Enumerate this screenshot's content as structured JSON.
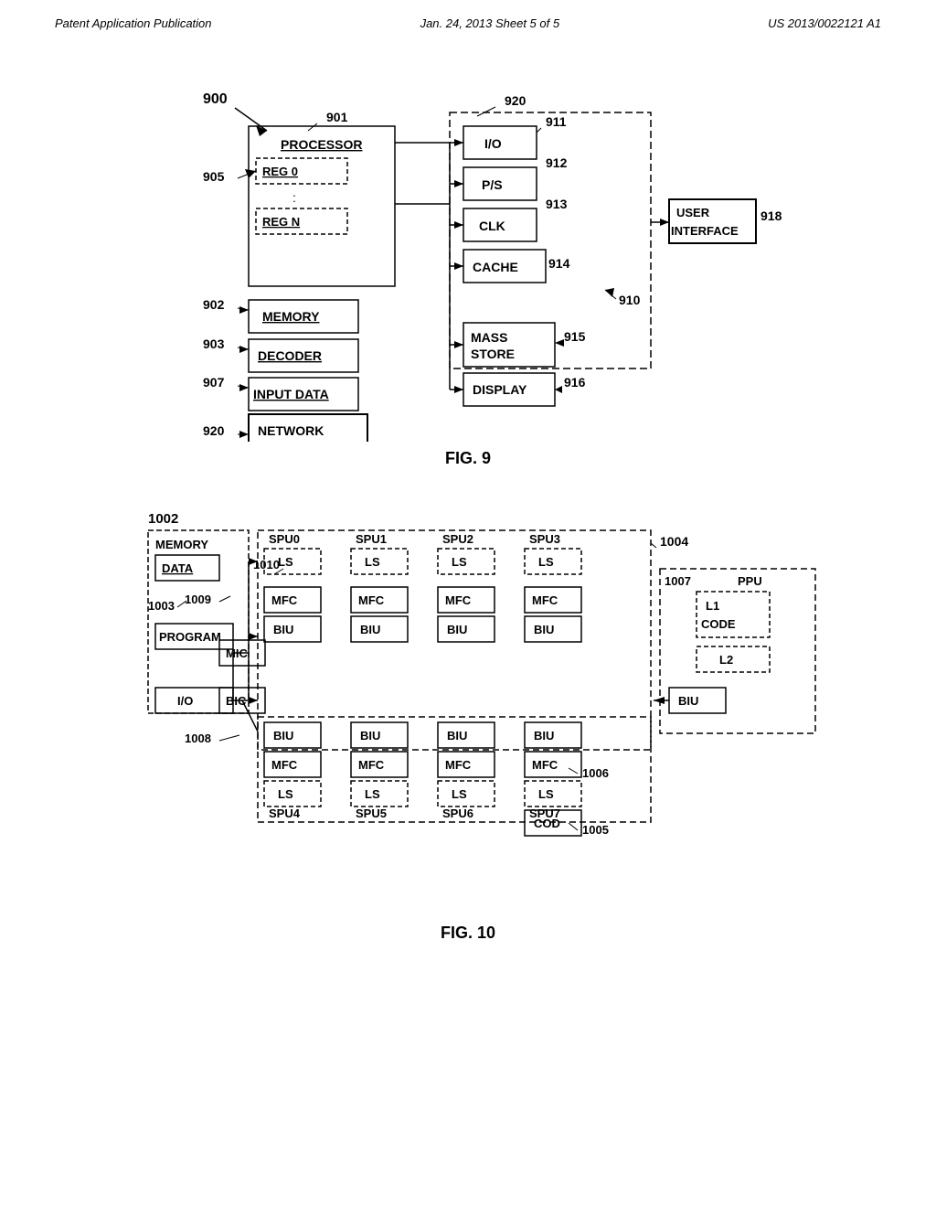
{
  "header": {
    "left": "Patent Application Publication",
    "center": "Jan. 24, 2013   Sheet 5 of 5",
    "right": "US 2013/0022121 A1"
  },
  "fig9": {
    "label": "FIG. 9",
    "nodes": {
      "900": "900",
      "901": "901",
      "902": "902",
      "903": "903",
      "905": "905",
      "907": "907",
      "910": "910",
      "911": "911",
      "912": "912",
      "913": "913",
      "914": "914",
      "915": "915",
      "916": "916",
      "918": "918",
      "920": "920"
    }
  },
  "fig10": {
    "label": "FIG. 10"
  }
}
